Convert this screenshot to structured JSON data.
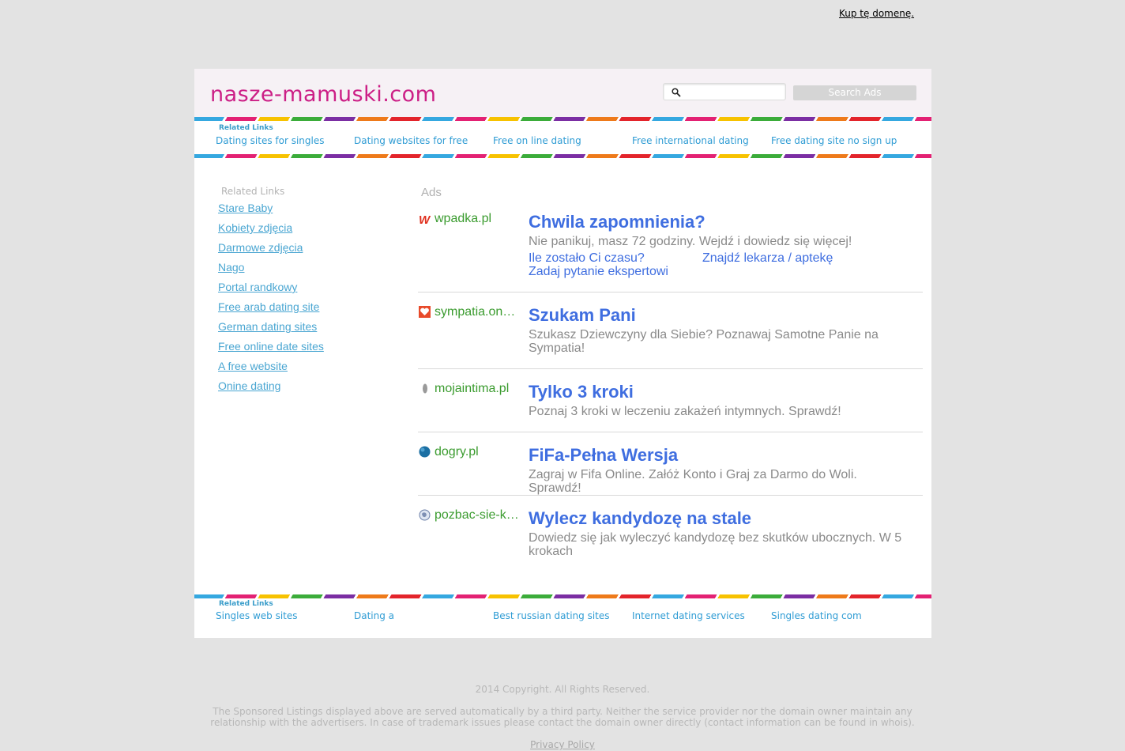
{
  "topbar": {
    "buy_domain": "Kup tę domenę."
  },
  "header": {
    "site_title": "nasze-mamuski.com",
    "search_placeholder": "",
    "search_button": "Search Ads"
  },
  "related_top": {
    "title": "Related Links",
    "links": [
      "Dating sites for singles",
      "Dating websites for free",
      "Free on line dating",
      "Free international dating",
      "Free dating site no sign up"
    ]
  },
  "sidebar": {
    "title": "Related Links",
    "links": [
      "Stare Baby",
      "Kobiety zdjęcia",
      "Darmowe zdjęcia",
      "Nago",
      "Portal randkowy",
      "Free arab dating site",
      "German dating sites",
      "Free online date sites",
      "A free website",
      "Onine dating"
    ]
  },
  "ads": {
    "label": "Ads",
    "items": [
      {
        "domain": "wpadka.pl",
        "icon": "wpadka-logo-icon",
        "title": "Chwila zapomnienia?",
        "desc": "Nie panikuj, masz 72 godziny. Wejdź i dowiedz się więcej!",
        "sitelinks": [
          "Ile zostało Ci czasu?",
          "Znajdź lekarza / aptekę",
          "Zadaj pytanie ekspertowi"
        ]
      },
      {
        "domain": "sympatia.onet.pl",
        "icon": "sympatia-heart-icon",
        "title": "Szukam Pani",
        "desc": "Szukasz Dziewczyny dla Siebie? Poznawaj Samotne Panie na Sympatia!"
      },
      {
        "domain": "mojaintima.pl",
        "icon": "mojaintima-leaf-icon",
        "title": "Tylko 3 kroki",
        "desc": "Poznaj 3 kroki w leczeniu zakażeń intymnych. Sprawdź!"
      },
      {
        "domain": "dogry.pl",
        "icon": "dogry-ball-icon",
        "title": "FiFa-Pełna Wersja",
        "desc": "Zagraj w Fifa Online. Załóż Konto i Graj za Darmo do Woli. Sprawdź!"
      },
      {
        "domain": "pozbac-sie-kandydozy.pl",
        "icon": "globe-icon",
        "title": "Wylecz kandydozę na stale",
        "desc": "Dowiedz się jak wyleczyć kandydozę bez skutków ubocznych. W 5 krokach"
      }
    ]
  },
  "related_bottom": {
    "title": "Related Links",
    "links": [
      "Singles web sites",
      "Dating a",
      "Best russian dating sites",
      "Internet dating services",
      "Singles dating com"
    ]
  },
  "footer": {
    "copyright": "2014 Copyright. All Rights Reserved.",
    "disclaimer": "The Sponsored Listings displayed above are served automatically by a third party. Neither the service provider nor the domain owner maintain any relationship with the advertisers. In case of trademark issues please contact the domain owner directly (contact information can be found in whois).",
    "privacy": "Privacy Policy"
  }
}
